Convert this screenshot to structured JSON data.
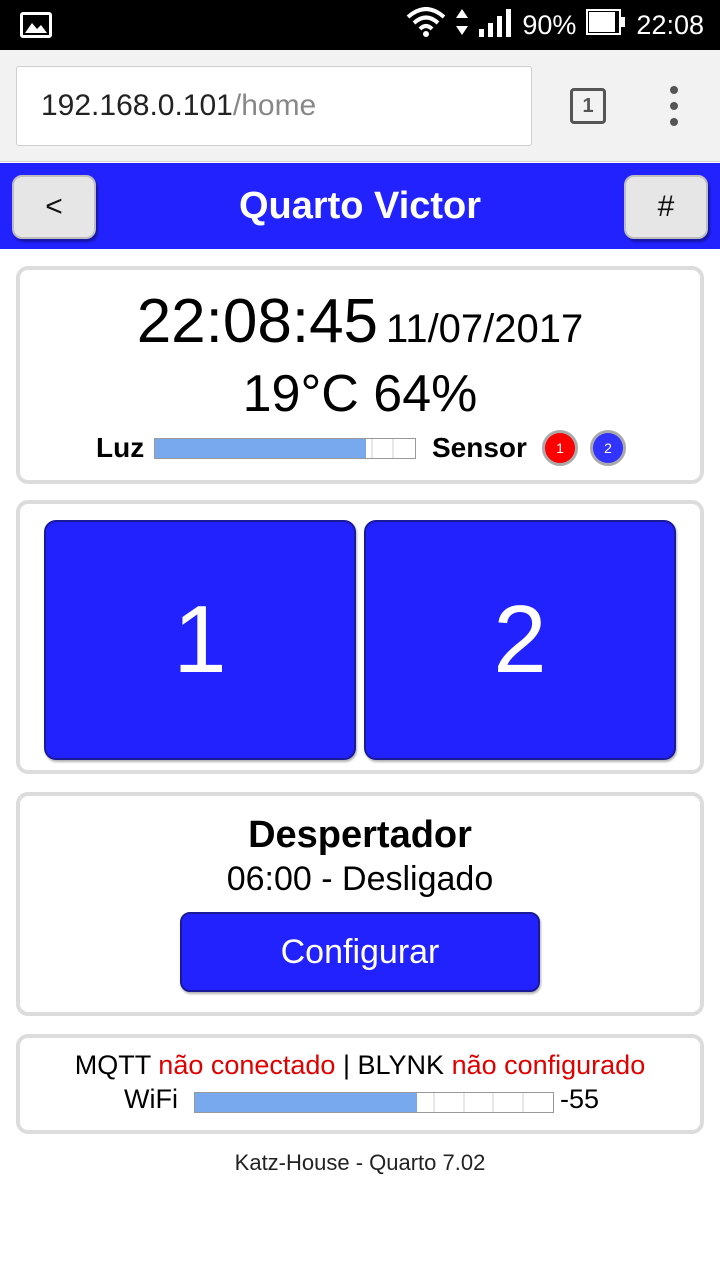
{
  "status_bar": {
    "battery_percent": "90%",
    "clock": "22:08",
    "icons": [
      "gallery-icon",
      "wifi-icon",
      "signal-icon",
      "battery-icon"
    ]
  },
  "browser": {
    "url_host": "192.168.0.101",
    "url_path": "/home",
    "tab_count": "1"
  },
  "header": {
    "back_label": "<",
    "title": "Quarto Victor",
    "menu_label": "#",
    "color": "#2222ff"
  },
  "info": {
    "time": "22:08:45",
    "date": "11/07/2017",
    "temp_humidity": "19°C 64%",
    "luz_label": "Luz",
    "luz_level": 0.81,
    "sensor_label": "Sensor",
    "sensors": [
      {
        "label": "1",
        "color": "#ff0000"
      },
      {
        "label": "2",
        "color": "#3333ff"
      }
    ]
  },
  "switches": [
    {
      "label": "1"
    },
    {
      "label": "2"
    }
  ],
  "alarm": {
    "title": "Despertador",
    "status": "06:00 - Desligado",
    "button": "Configurar"
  },
  "connection": {
    "mqtt_label": "MQTT",
    "mqtt_status": "não conectado",
    "separator": "|",
    "blynk_label": "BLYNK",
    "blynk_status": "não configurado",
    "wifi_label": "WiFi",
    "wifi_level": 0.62,
    "wifi_value": "-55"
  },
  "footer": "Katz-House - Quarto 7.02"
}
